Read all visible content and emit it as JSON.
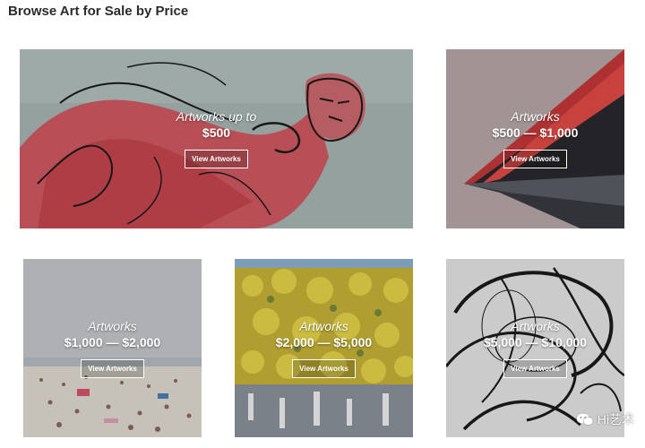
{
  "page": {
    "title": "Browse Art for Sale by Price"
  },
  "tiles": [
    {
      "label_top": "Artworks up to",
      "label_price": "$500",
      "button": "View Artworks"
    },
    {
      "label_top": "Artworks",
      "label_price": "$500 — $1,000",
      "button": "View Artworks"
    },
    {
      "label_top": "Artworks",
      "label_price": "$1,000 — $2,000",
      "button": "View Artworks"
    },
    {
      "label_top": "Artworks",
      "label_price": "$2,000 — $5,000",
      "button": "View Artworks"
    },
    {
      "label_top": "Artworks",
      "label_price": "$5,000 — $10,000",
      "button": "View Artworks"
    }
  ],
  "watermark": {
    "text": "Hi艺术",
    "icon": "wechat-icon"
  }
}
